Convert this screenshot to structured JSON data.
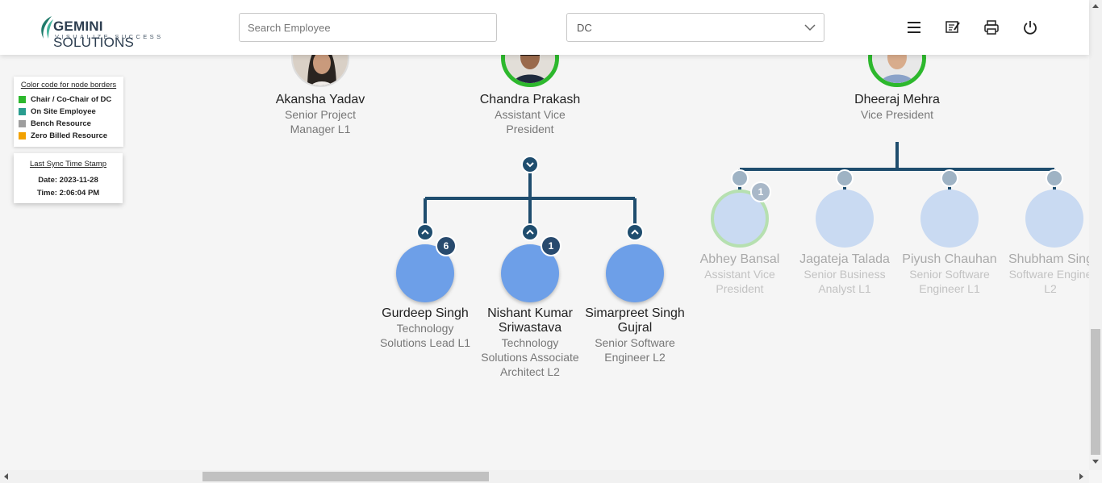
{
  "header": {
    "logo_brand_bold": "GEMINI",
    "logo_brand_rest": " SOLUTIONS",
    "logo_tagline": "VISUALIZE SUCCESS",
    "search_placeholder": "Search Employee",
    "department_selected": "DC",
    "icons": [
      "menu-icon",
      "feedback-icon",
      "print-icon",
      "power-icon"
    ]
  },
  "legend": {
    "title": "Color code for node borders",
    "items": [
      {
        "label": "Chair / Co-Chair of DC",
        "color": "#2db82d"
      },
      {
        "label": "On Site Employee",
        "color": "#2a9d8f"
      },
      {
        "label": "Bench Resource",
        "color": "#9e9e9e"
      },
      {
        "label": "Zero Billed Resource",
        "color": "#f2a100"
      }
    ]
  },
  "sync": {
    "title": "Last Sync Time Stamp",
    "date": "Date: 2023-11-28",
    "time": "Time: 2:06:04 PM"
  },
  "nodes": {
    "akansha": {
      "name": "Akansha Yadav",
      "title": "Senior Project Manager L1"
    },
    "chandra": {
      "name": "Chandra Prakash",
      "title": "Assistant Vice President"
    },
    "dheeraj": {
      "name": "Dheeraj Mehra",
      "title": "Vice President"
    },
    "gurdeep": {
      "name": "Gurdeep Singh",
      "title": "Technology Solutions Lead L1",
      "badge": "6"
    },
    "nishant": {
      "name": "Nishant Kumar Sriwastava",
      "title": "Technology Solutions Associate Architect L2",
      "badge": "1"
    },
    "simarpreet": {
      "name": "Simarpreet Singh Gujral",
      "title": "Senior Software Engineer L2"
    },
    "abhey": {
      "name": "Abhey Bansal",
      "title": "Assistant Vice President",
      "badge": "1"
    },
    "jagateja": {
      "name": "Jagateja Talada",
      "title": "Senior Business Analyst L1"
    },
    "piyush": {
      "name": "Piyush Chauhan",
      "title": "Senior Software Engineer L1"
    },
    "shubham": {
      "name": "Shubham Sing",
      "title": "Software Engine L2"
    }
  },
  "colors": {
    "connector": "#1f4d6e",
    "chair_border": "#2db82d",
    "node_fill": "#6d9fe8"
  }
}
